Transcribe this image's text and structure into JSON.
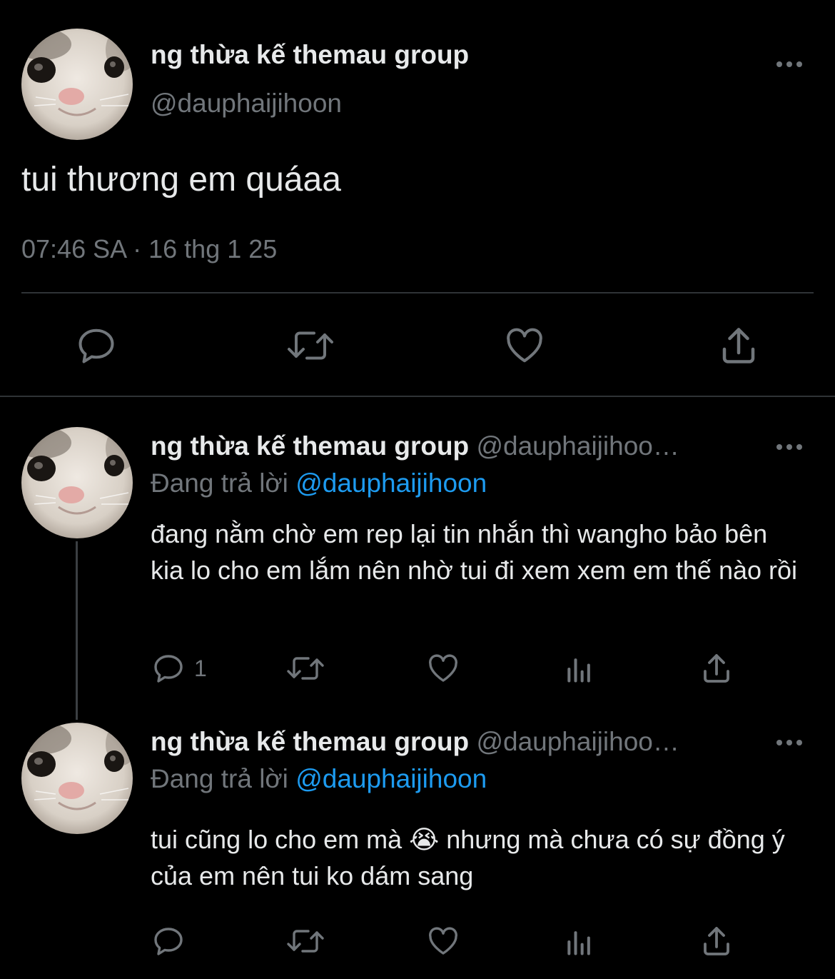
{
  "main_tweet": {
    "display_name": "ng thừa kế themau group",
    "handle": "@dauphaijihoon",
    "text": "tui thương em quáaa",
    "timestamp": "07:46 SA · 16 thg 1 25"
  },
  "replies": [
    {
      "display_name": "ng thừa kế themau group",
      "handle": "@dauphaijihoo…",
      "replying_prefix": "Đang trả lời",
      "replying_to": "@dauphaijihoon",
      "text": "đang nằm chờ em rep lại tin nhắn thì wangho bảo bên kia lo cho em lắm nên nhờ tui đi xem xem em thế nào rồi",
      "reply_count": "1"
    },
    {
      "display_name": "ng thừa kế themau group",
      "handle": "@dauphaijihoo…",
      "replying_prefix": "Đang trả lời",
      "replying_to": "@dauphaijihoon",
      "text": "tui cũng lo cho em mà 😭 nhưng mà chưa có sự đồng ý của em nên tui ko dám sang",
      "reply_count": ""
    }
  ],
  "icons": [
    "reply-icon",
    "retweet-icon",
    "like-icon",
    "share-icon",
    "views-icon",
    "more-icon"
  ],
  "colors": {
    "background": "#000000",
    "text": "#e7e9ea",
    "muted": "#71767b",
    "link": "#1d9bf0",
    "divider": "#2f3336"
  }
}
